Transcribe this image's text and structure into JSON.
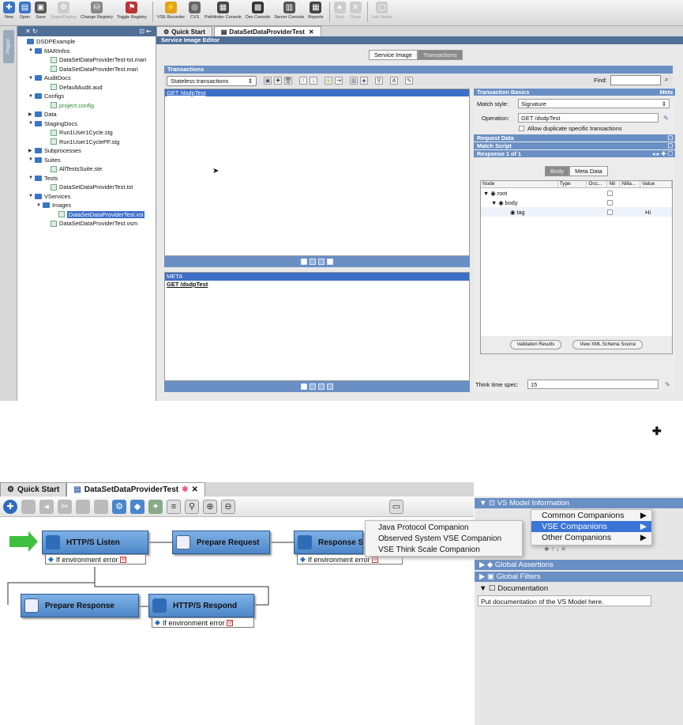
{
  "toolbar": {
    "items": [
      {
        "label": "New",
        "icon": "new-icon",
        "color": "#3a74c6"
      },
      {
        "label": "Open",
        "icon": "open-icon",
        "color": "#3a74c6"
      },
      {
        "label": "Save",
        "icon": "save-icon",
        "color": "#555"
      },
      {
        "label": "Stage/Deploy",
        "icon": "stage-deploy-icon",
        "color": "#888",
        "disabled": true
      },
      {
        "label": "Change Registry",
        "icon": "change-registry-icon",
        "color": "#888"
      },
      {
        "label": "Toggle Registry",
        "icon": "toggle-registry-icon",
        "color": "#b33"
      },
      {
        "label": "VSE Recorder",
        "icon": "recorder-icon",
        "color": "#e2a21a"
      },
      {
        "label": "CVS",
        "icon": "cvs-icon",
        "color": "#666"
      },
      {
        "label": "Pathfinder Console",
        "icon": "pathfinder-icon",
        "color": "#444"
      },
      {
        "label": "Dev Console",
        "icon": "dev-console-icon",
        "color": "#333"
      },
      {
        "label": "Server Console",
        "icon": "server-console-icon",
        "color": "#555"
      },
      {
        "label": "Reports",
        "icon": "reports-icon",
        "color": "#444"
      },
      {
        "label": "Stop",
        "icon": "stop-icon",
        "color": "#999",
        "disabled": true
      },
      {
        "label": "Close",
        "icon": "close-icon",
        "color": "#999",
        "disabled": true
      },
      {
        "label": "Lab Status",
        "icon": "lab-status-icon",
        "color": "#999",
        "disabled": true
      }
    ]
  },
  "sidebar": {
    "tab_label": "Project",
    "tree": [
      {
        "label": "DSDPExample",
        "indent": 0,
        "twist": "",
        "type": "root"
      },
      {
        "label": "MARInfos",
        "indent": 1,
        "twist": "▼",
        "type": "folder"
      },
      {
        "label": "DataSetDataProviderTest-tst.mari",
        "indent": 3,
        "twist": "",
        "type": "file"
      },
      {
        "label": "DataSetDataProviderTest.mari",
        "indent": 3,
        "twist": "",
        "type": "file"
      },
      {
        "label": "AuditDocs",
        "indent": 1,
        "twist": "▼",
        "type": "folder"
      },
      {
        "label": "DefaultAudit.aud",
        "indent": 3,
        "twist": "",
        "type": "file"
      },
      {
        "label": "Configs",
        "indent": 1,
        "twist": "▼",
        "type": "folder"
      },
      {
        "label": "project.config",
        "indent": 3,
        "twist": "",
        "type": "file",
        "green": true
      },
      {
        "label": "Data",
        "indent": 1,
        "twist": "▶",
        "type": "folder"
      },
      {
        "label": "StagingDocs",
        "indent": 1,
        "twist": "▼",
        "type": "folder"
      },
      {
        "label": "Run1User1Cycle.stg",
        "indent": 3,
        "twist": "",
        "type": "file"
      },
      {
        "label": "Run1User1CyclePF.stg",
        "indent": 3,
        "twist": "",
        "type": "file"
      },
      {
        "label": "Subprocesses",
        "indent": 1,
        "twist": "▶",
        "type": "folder"
      },
      {
        "label": "Suites",
        "indent": 1,
        "twist": "▼",
        "type": "folder"
      },
      {
        "label": "AllTestsSuite.ste",
        "indent": 3,
        "twist": "",
        "type": "file"
      },
      {
        "label": "Tests",
        "indent": 1,
        "twist": "▼",
        "type": "folder"
      },
      {
        "label": "DataSetDataProviderTest.tst",
        "indent": 3,
        "twist": "",
        "type": "file"
      },
      {
        "label": "VServices",
        "indent": 1,
        "twist": "▼",
        "type": "folder"
      },
      {
        "label": "Images",
        "indent": 2,
        "twist": "▼",
        "type": "folder"
      },
      {
        "label": "DataSetDataProviderTest.vsi",
        "indent": 4,
        "twist": "",
        "type": "file",
        "selected": true
      },
      {
        "label": "DataSetDataProviderTest.vsm",
        "indent": 3,
        "twist": "",
        "type": "file"
      }
    ]
  },
  "editor": {
    "tabs": [
      "Quick Start",
      "DataSetDataProviderTest"
    ],
    "title": "Service Image Editor",
    "seg": [
      "Service Image",
      "Transactions"
    ],
    "transactions_header": "Transactions",
    "mode_select": "Stateless transactions",
    "find_label": "Find:",
    "list_item": "GET /dsdpTest",
    "meta_header": "META",
    "meta_item": "GET /dsdpTest"
  },
  "basics": {
    "header": "Transaction Basics",
    "header_right": "Meta",
    "match_style_label": "Match style:",
    "match_style_value": "Signature",
    "operation_label": "Operation:",
    "operation_value": "GET /dsdpTest",
    "allow_dup_label": "Allow duplicate specific transactions",
    "request_data": "Request Data",
    "match_script": "Match Script",
    "response": "Response 1 of 1",
    "body_tabs": [
      "Body",
      "Meta Data"
    ],
    "grid_headers": [
      "Node",
      "Type",
      "Occ...",
      "Nil",
      "Nilla...",
      "Value"
    ],
    "grid_rows": [
      {
        "node": "root",
        "value": ""
      },
      {
        "node": "body",
        "value": ""
      },
      {
        "node": "tag",
        "value": "Hi"
      }
    ],
    "validation_btn": "Validation Results",
    "xml_btn": "View XML Schema Source",
    "think_label": "Think time spec:",
    "think_value": "15"
  },
  "lower": {
    "tabs": [
      "Quick Start",
      "DataSetDataProviderTest"
    ],
    "steps": {
      "listen": "HTTP/S Listen",
      "prepare_request": "Prepare Request",
      "response_s": "Response S",
      "prepare_response": "Prepare Response",
      "respond": "HTTP/S Respond"
    },
    "error_label": "If environment error",
    "vsm_panel": {
      "header": "VS Model Information",
      "global_assertions": "Global Assertions",
      "global_filters": "Global Filters",
      "documentation": "Documentation",
      "doc_text": "Put documentation of the VS Model here."
    },
    "menu_main": [
      {
        "label": "Common Companions",
        "highlighted": false
      },
      {
        "label": "VSE Companions",
        "highlighted": true
      },
      {
        "label": "Other Companions",
        "highlighted": false
      }
    ],
    "menu_sub": [
      "Java Protocol Companion",
      "Observed System VSE Companion",
      "VSE Think Scale Companion"
    ]
  }
}
